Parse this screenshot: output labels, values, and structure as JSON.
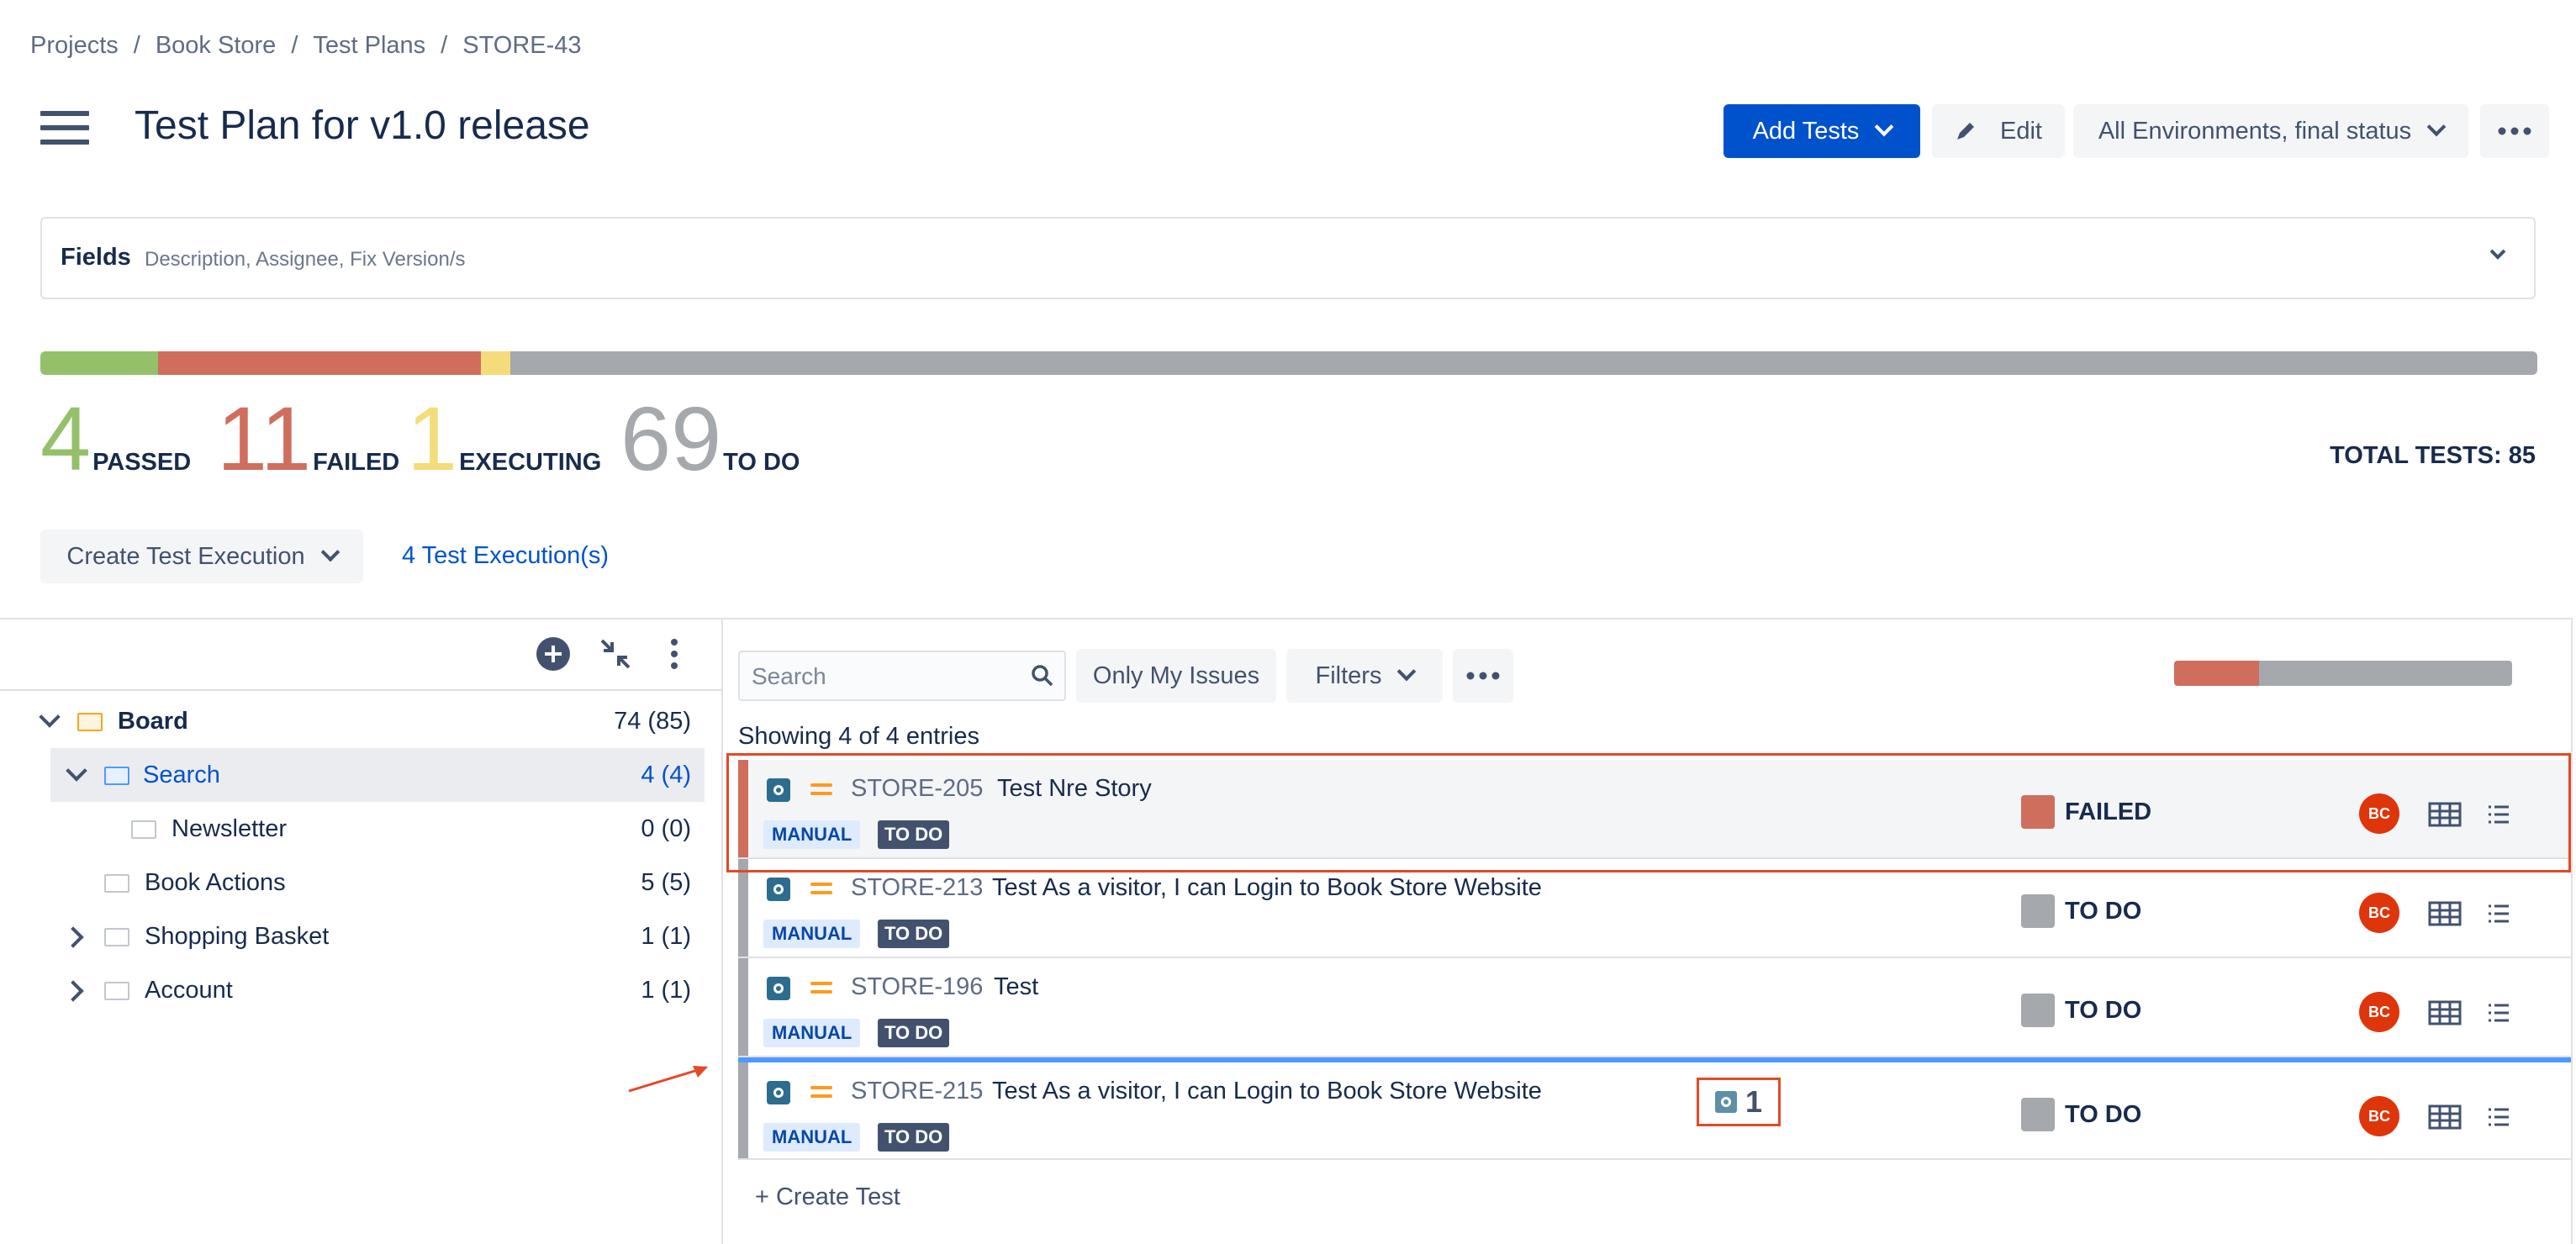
{
  "breadcrumb": [
    "Projects",
    "Book Store",
    "Test Plans",
    "STORE-43"
  ],
  "header": {
    "title": "Test Plan for v1.0 release",
    "add_tests_label": "Add Tests",
    "edit_label": "Edit",
    "env_label": "All Environments, final status",
    "more_icon": "ellipsis-icon"
  },
  "fields": {
    "label": "Fields",
    "description": "Description, Assignee, Fix Version/s"
  },
  "progress": {
    "total": 85,
    "passed": 4,
    "failed": 11,
    "executing": 1,
    "todo": 69,
    "colors": {
      "passed": "#94c06a",
      "failed": "#cf6e5d",
      "executing": "#f4dc7a",
      "todo": "#a5a9ad"
    }
  },
  "stats": [
    {
      "value": "4",
      "label": "PASSED",
      "color": "#94c06a"
    },
    {
      "value": "11",
      "label": "FAILED",
      "color": "#cf6e5d"
    },
    {
      "value": "1",
      "label": "EXECUTING",
      "color": "#f4dc7a"
    },
    {
      "value": "69",
      "label": "TO DO",
      "color": "#a5a9ad"
    }
  ],
  "total_label": "TOTAL TESTS: 85",
  "create_execution_label": "Create Test Execution",
  "executions_link": "4 Test Execution(s)",
  "tree": [
    {
      "label": "Board",
      "count": "74 (85)",
      "bold": true,
      "expanded": true
    },
    {
      "label": "Search",
      "count": "4 (4)",
      "selected": true,
      "expanded": true
    },
    {
      "label": "Newsletter",
      "count": "0 (0)"
    },
    {
      "label": "Book Actions",
      "count": "5 (5)"
    },
    {
      "label": "Shopping Basket",
      "count": "1 (1)",
      "collapsed": true
    },
    {
      "label": "Account",
      "count": "1 (1)",
      "collapsed": true
    }
  ],
  "toolbar": {
    "search_placeholder": "Search",
    "only_my_issues": "Only My Issues",
    "filters": "Filters"
  },
  "mini_progress": {
    "failed_fraction": 0.25,
    "todo_fraction": 0.75
  },
  "showing_text": "Showing 4 of 4 entries",
  "tests": [
    {
      "key": "STORE-205",
      "summary": "Test Nre Story",
      "type": "MANUAL",
      "status_tag": "TO DO",
      "status": "FAILED",
      "status_color": "#cf6e5d",
      "avatar": "BC"
    },
    {
      "key": "STORE-213",
      "summary": "Test As a visitor, I can Login to Book Store Website",
      "type": "MANUAL",
      "status_tag": "TO DO",
      "status": "TO DO",
      "status_color": "#a5a9ad",
      "avatar": "BC"
    },
    {
      "key": "STORE-196",
      "summary": "Test",
      "type": "MANUAL",
      "status_tag": "TO DO",
      "status": "TO DO",
      "status_color": "#a5a9ad",
      "avatar": "BC"
    },
    {
      "key": "STORE-215",
      "summary": "Test As a visitor, I can Login to Book Store Website",
      "type": "MANUAL",
      "status_tag": "TO DO",
      "status": "TO DO",
      "status_color": "#a5a9ad",
      "avatar": "BC",
      "exec_count": "1"
    }
  ],
  "create_test_label": "+ Create Test"
}
